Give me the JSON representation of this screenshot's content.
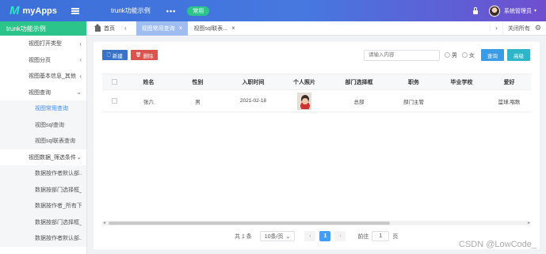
{
  "app": {
    "logo_mark": "M",
    "name": "myApps"
  },
  "topbar": {
    "module_title": "trunk功能示例",
    "more": "•••",
    "badge": "常用",
    "user_name": "系统管理员",
    "user_caret": "▾"
  },
  "sidebar": {
    "header": "trunk功能示例",
    "items": [
      {
        "label": "视图打开类型",
        "arrow": "‹"
      },
      {
        "label": "视图分页",
        "arrow": "‹"
      },
      {
        "label": "视图基本信息_其他",
        "arrow": "‹"
      },
      {
        "label": "视图查询",
        "arrow": "⌄"
      },
      {
        "label": "视图常用查询",
        "arrow": ""
      },
      {
        "label": "视图sql查询",
        "arrow": ""
      },
      {
        "label": "视图sql联表查询",
        "arrow": ""
      },
      {
        "label": "视图数据_筛选条件",
        "arrow": "⌄"
      },
      {
        "label": "数据按作者默认部...",
        "arrow": ""
      },
      {
        "label": "数据按部门选择框_...",
        "arrow": ""
      },
      {
        "label": "数据按作者_所有下...",
        "arrow": ""
      },
      {
        "label": "数据按部门选择框_...",
        "arrow": ""
      },
      {
        "label": "数据按作者默认部...",
        "arrow": ""
      }
    ]
  },
  "tabs": {
    "home": "首页",
    "prev": "‹",
    "items": [
      {
        "label": "视图常用查询",
        "close": "×"
      },
      {
        "label": "视图sql联表...",
        "close": "×"
      }
    ],
    "next": "›",
    "close_all": "关闭所有"
  },
  "toolbar": {
    "new_label": "新建",
    "delete_label": "删除"
  },
  "search": {
    "placeholder": "请输入内容",
    "radio_male": "男",
    "radio_female": "女",
    "query_label": "查询",
    "advanced_label": "高级"
  },
  "table": {
    "columns": [
      "姓名",
      "性别",
      "入职时间",
      "个人照片",
      "部门选择框",
      "职务",
      "毕业学校",
      "爱好"
    ],
    "rows": [
      [
        "张六",
        "男",
        "2021-02-18",
        "",
        "总部",
        "部门主管",
        "",
        "篮球,唱歌"
      ]
    ]
  },
  "pagination": {
    "total": "共 1 条",
    "page_size": "10条/页",
    "size_caret": "⌄",
    "prev": "‹",
    "current": "1",
    "next": "›",
    "goto_label": "前往",
    "goto_value": "1",
    "page_unit": "页"
  },
  "watermark": "CSDN @LowCode_"
}
